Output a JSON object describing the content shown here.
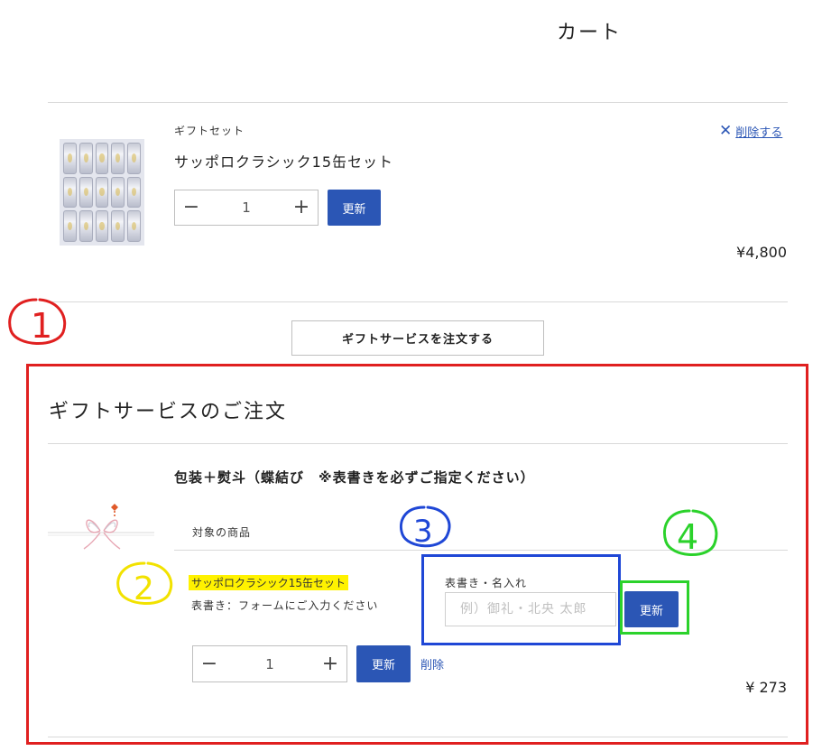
{
  "header": {
    "title": "カート"
  },
  "cart_item": {
    "category": "ギフトセット",
    "name": "サッポロクラシック15缶セット",
    "quantity": "1",
    "minus_icon": "−",
    "plus_icon": "+",
    "update_label": "更新",
    "remove_label": "削除する",
    "price": "¥4,800"
  },
  "gift_order_button": "ギフトサービスを注文する",
  "gift_section": {
    "title": "ギフトサービスのご注文",
    "service_name": "包装＋熨斗（蝶結び　※表書きを必ずご指定ください）",
    "target_label": "対象の商品",
    "target_product": "サッポロクラシック15缶セット",
    "omote_note": "表書き：フォームにご入力ください",
    "omote_label": "表書き・名入れ",
    "omote_placeholder": "例）御礼・北央 太郎",
    "omote_update_label": "更新",
    "quantity": "1",
    "minus_icon": "−",
    "plus_icon": "+",
    "update_label": "更新",
    "delete_label": "削除",
    "price": "¥ 273"
  },
  "annotations": {
    "n1": "1",
    "n2": "2",
    "n3": "3",
    "n4": "4",
    "colors": {
      "red": "#e02020",
      "yellow": "#f2e200",
      "blue": "#1f47d6",
      "green": "#2bd22b"
    }
  }
}
